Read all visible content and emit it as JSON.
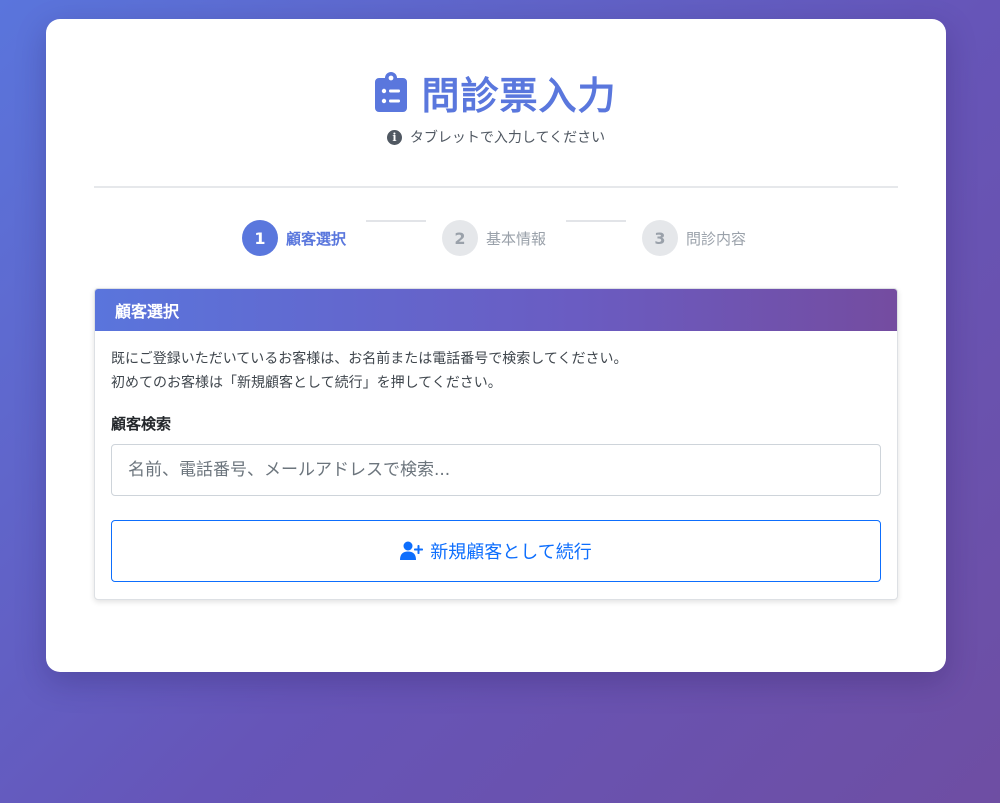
{
  "header": {
    "title": "問診票入力",
    "title_icon": "clipboard-list-icon",
    "subtitle": "タブレットで入力してください",
    "subtitle_icon": "info-circle-icon",
    "accent_color": "#5a77dd"
  },
  "steps": [
    {
      "number": "1",
      "label": "顧客選択",
      "state": "active"
    },
    {
      "number": "2",
      "label": "基本情報",
      "state": "inactive"
    },
    {
      "number": "3",
      "label": "問診内容",
      "state": "inactive"
    }
  ],
  "panel": {
    "title": "顧客選択",
    "description_line1": "既にご登録いただいているお客様は、お名前または電話番号で検索してください。",
    "description_line2": "初めてのお客様は「新規顧客として続行」を押してください。",
    "search_label": "顧客検索",
    "search_placeholder": "名前、電話番号、メールアドレスで検索...",
    "search_value": "",
    "new_customer_button": "新規顧客として続行",
    "new_customer_icon": "user-plus-icon",
    "button_color": "#0d6efd"
  }
}
